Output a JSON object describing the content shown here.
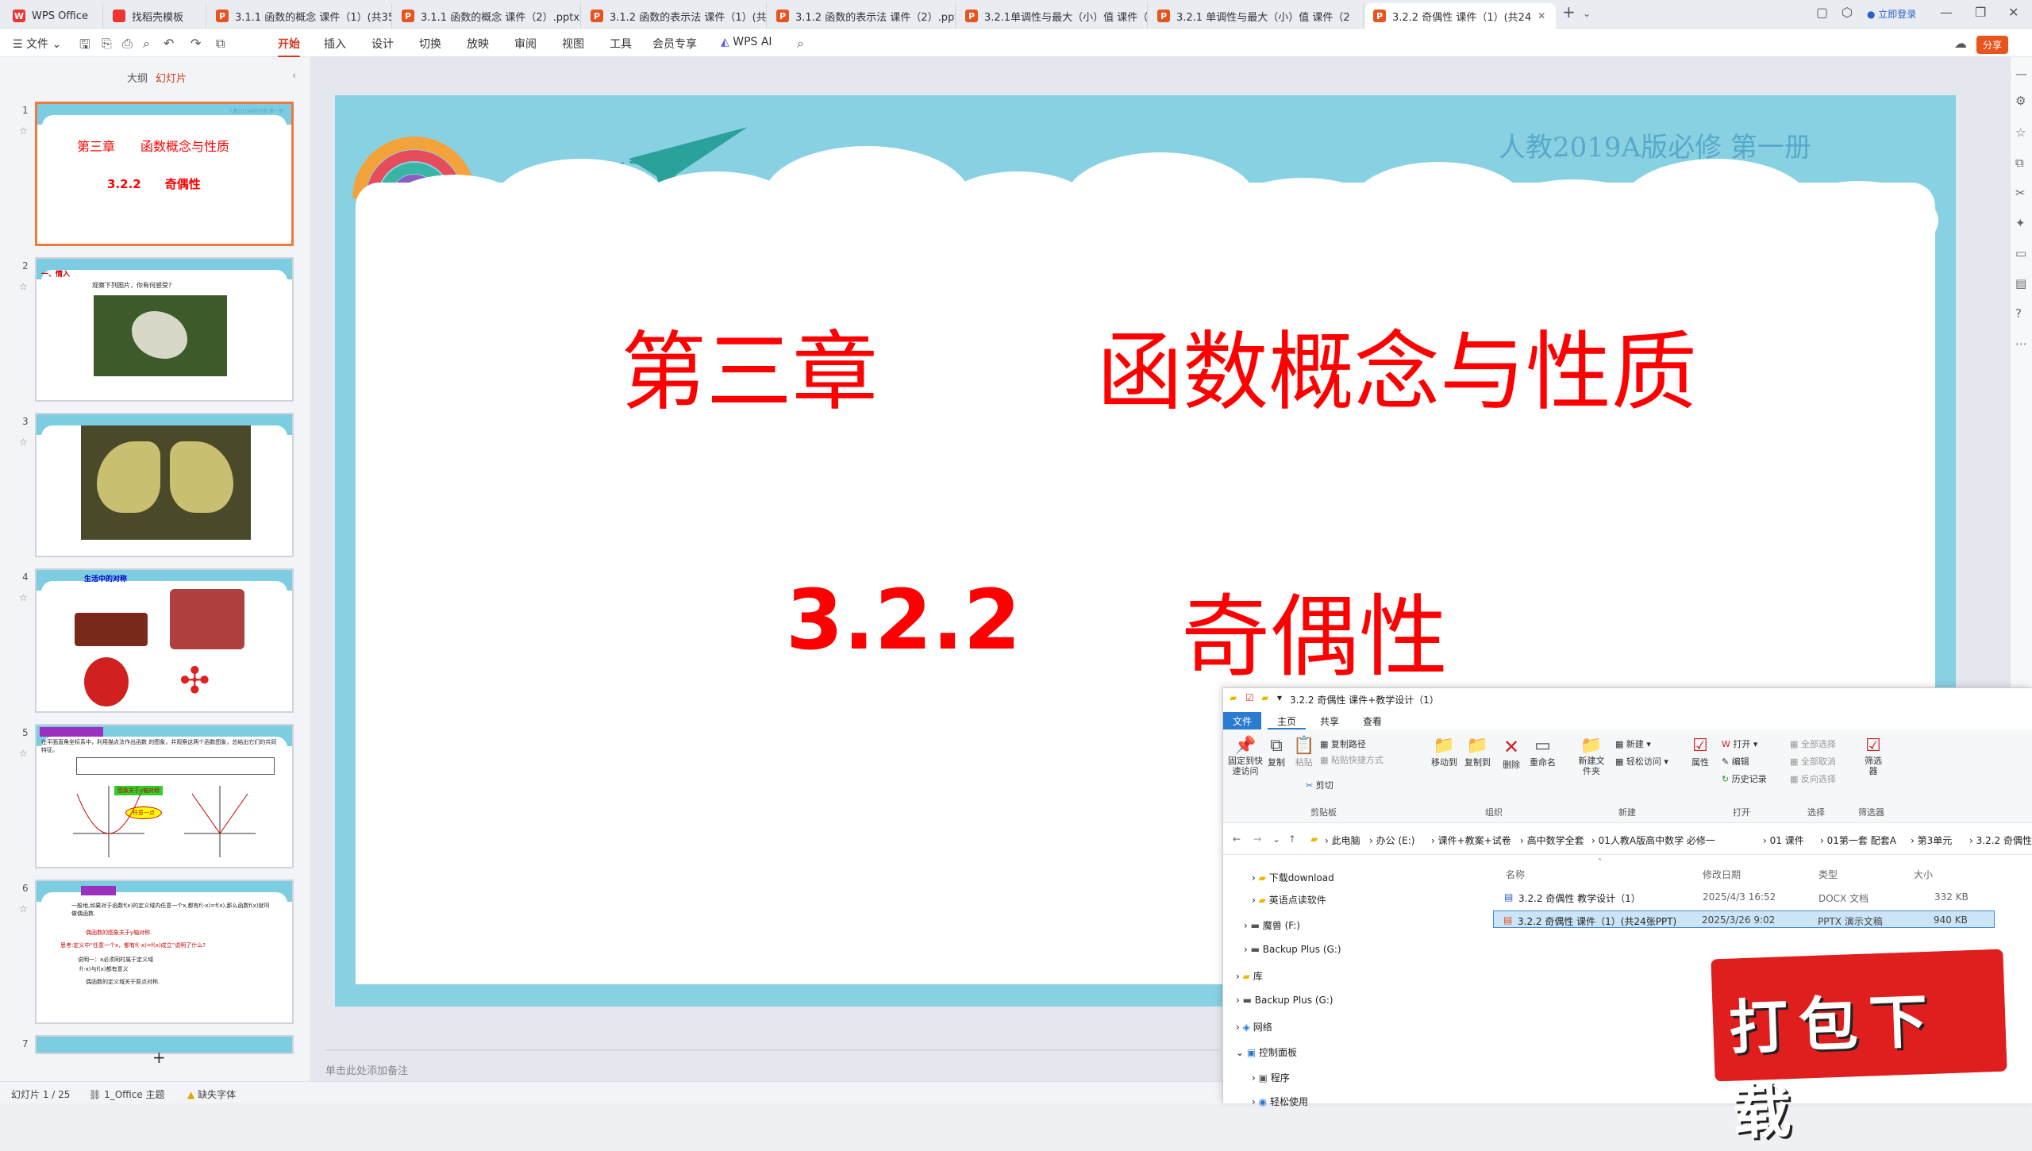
{
  "tabs": [
    {
      "label": "WPS Office",
      "type": "wps"
    },
    {
      "label": "找稻壳模板",
      "type": "template"
    },
    {
      "label": "3.1.1 函数的概念 课件（1）(共35张",
      "type": "ppt"
    },
    {
      "label": "3.1.1 函数的概念 课件（2）.pptx",
      "type": "ppt"
    },
    {
      "label": "3.1.2 函数的表示法 课件（1）(共28",
      "type": "ppt"
    },
    {
      "label": "3.1.2 函数的表示法 课件（2）.pptx",
      "type": "ppt"
    },
    {
      "label": "3.2.1单调性与最大（小）值 课件（1",
      "type": "ppt"
    },
    {
      "label": "3.2.1 单调性与最大（小）值 课件（2",
      "type": "ppt"
    },
    {
      "label": "3.2.2 奇偶性 课件（1）(共24",
      "type": "ppt",
      "active": true
    }
  ],
  "login": "立即登录",
  "menubar": {
    "file": "文件",
    "items": [
      "开始",
      "插入",
      "设计",
      "切换",
      "放映",
      "审阅",
      "视图",
      "工具",
      "会员专享"
    ],
    "active": "开始",
    "wpsai": "WPS AI",
    "share": "分享"
  },
  "panel": {
    "outline": "大纲",
    "slides": "幻灯片",
    "add": "+"
  },
  "thumbs": [
    {
      "num": "1",
      "title": "第三章　　函数概念与性质",
      "sub": "3.2.2　　奇偶性",
      "header": "人教2019A版必修 第一册"
    },
    {
      "num": "2",
      "label": "一、情入",
      "text": "观察下列图片，你有何感受?"
    },
    {
      "num": "3"
    },
    {
      "num": "4",
      "label": "生活中的对称"
    },
    {
      "num": "5",
      "text": "在平面直角坐标系中，利用描点法作出函数 的图象，并观察这两个函数图象，总结出它们的共同特征。",
      "badge": "图象关于y轴对称",
      "bubble": "任意一点"
    },
    {
      "num": "6",
      "text": "一般地,如果对于函数f(x)的定义域内任意一个x,都有f(-x)=f(x),那么函数f(x)就叫做偶函数.",
      "l2": "偶函数的图象关于y轴对称.",
      "l3": "思考:定义中“任意一个x，都有f(-x)=f(x)成立”说明了什么?",
      "l4": "说明一：x必须同时属于定义域",
      "l5": "f(-x)与f(x)都有意义",
      "l6": "偶函数的定义域关于原点对称."
    },
    {
      "num": "7"
    }
  ],
  "slide": {
    "header": "人教2019A版必修 第一册",
    "chapter": "第三章",
    "chapter_title": "函数概念与性质",
    "section": "3.2.2",
    "section_title": "奇偶性",
    "colors": {
      "bg": "#88d1e3",
      "title": "#ff0000",
      "header": "#5aa8c8"
    }
  },
  "notes": "单击此处添加备注",
  "status": {
    "slide": "幻灯片 1 / 25",
    "theme": "1_Office 主题",
    "font": "缺失字体"
  },
  "explorer": {
    "title": "3.2.2 奇偶性 课件+教学设计（1）",
    "ribbon_tabs": [
      "文件",
      "主页",
      "共享",
      "查看"
    ],
    "buttons": {
      "pin": "固定到快速访问",
      "copy": "复制",
      "paste": "粘贴",
      "copypath": "复制路径",
      "pasteshortcut": "粘贴快捷方式",
      "cut": "剪切",
      "moveto": "移动到",
      "copyto": "复制到",
      "delete": "删除",
      "rename": "重命名",
      "newfolder": "新建文件夹",
      "newitem": "新建",
      "easyaccess": "轻松访问",
      "properties": "属性",
      "open": "打开",
      "edit": "编辑",
      "history": "历史记录",
      "selectall": "全部选择",
      "selectnone": "全部取消",
      "invert": "反向选择",
      "filter": "筛选器"
    },
    "groups": [
      "剪贴板",
      "组织",
      "新建",
      "打开",
      "选择",
      "筛选器"
    ],
    "breadcrumbs": [
      "此电脑",
      "办公 (E:)",
      "课件+教案+试卷",
      "高中数学全套",
      "01人教A版高中数学 必修一",
      "01 课件",
      "01第一套 配套A",
      "第3单元",
      "3.2.2 奇偶性"
    ],
    "tree": [
      "下载download",
      "英语点读软件",
      "魔兽 (F:)",
      "Backup Plus (G:)",
      "库",
      "Backup Plus (G:)",
      "网络",
      "控制面板",
      "程序",
      "轻松使用"
    ],
    "columns": [
      "名称",
      "修改日期",
      "类型",
      "大小"
    ],
    "files": [
      {
        "name": "3.2.2 奇偶性 教学设计（1）",
        "date": "2025/4/3 16:52",
        "type": "DOCX 文档",
        "size": "332 KB",
        "kind": "docx"
      },
      {
        "name": "3.2.2 奇偶性 课件（1）(共24张PPT)",
        "date": "2025/3/26 9:02",
        "type": "PPTX 演示文稿",
        "size": "940 KB",
        "kind": "pptx",
        "selected": true
      }
    ]
  },
  "stamp": "打包下载"
}
